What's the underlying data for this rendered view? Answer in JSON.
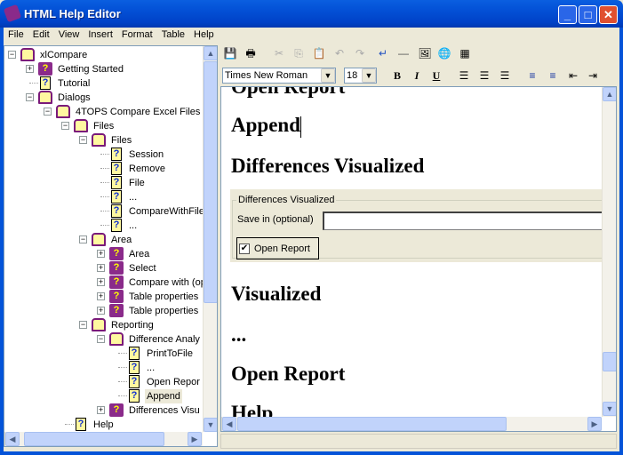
{
  "window": {
    "title": "HTML Help Editor"
  },
  "menu": [
    "File",
    "Edit",
    "View",
    "Insert",
    "Format",
    "Table",
    "Help"
  ],
  "tree": [
    {
      "label": "xlCompare",
      "d": 0,
      "t": "open",
      "e": "-"
    },
    {
      "label": "Getting Started",
      "d": 1,
      "t": "book",
      "e": "+"
    },
    {
      "label": "Tutorial",
      "d": 1,
      "t": "page",
      "e": ""
    },
    {
      "label": "Dialogs",
      "d": 1,
      "t": "open",
      "e": "-"
    },
    {
      "label": "4TOPS Compare Excel Files",
      "d": 2,
      "t": "open",
      "e": "-"
    },
    {
      "label": "Files",
      "d": 3,
      "t": "open",
      "e": "-"
    },
    {
      "label": "Files",
      "d": 4,
      "t": "open",
      "e": "-"
    },
    {
      "label": "Session",
      "d": 5,
      "t": "page",
      "e": ""
    },
    {
      "label": "Remove",
      "d": 5,
      "t": "page",
      "e": ""
    },
    {
      "label": "File",
      "d": 5,
      "t": "page",
      "e": ""
    },
    {
      "label": "...",
      "d": 5,
      "t": "page",
      "e": ""
    },
    {
      "label": "CompareWithFile",
      "d": 5,
      "t": "page",
      "e": ""
    },
    {
      "label": "...",
      "d": 5,
      "t": "page",
      "e": ""
    },
    {
      "label": "Area",
      "d": 4,
      "t": "open",
      "e": "-"
    },
    {
      "label": "Area",
      "d": 5,
      "t": "book",
      "e": "+"
    },
    {
      "label": "Select",
      "d": 5,
      "t": "book",
      "e": "+"
    },
    {
      "label": "Compare with (op",
      "d": 5,
      "t": "book",
      "e": "+"
    },
    {
      "label": "Table properties",
      "d": 5,
      "t": "book",
      "e": "+"
    },
    {
      "label": "Table properties",
      "d": 5,
      "t": "book",
      "e": "+"
    },
    {
      "label": "Reporting",
      "d": 4,
      "t": "open",
      "e": "-"
    },
    {
      "label": "Difference Analy",
      "d": 5,
      "t": "open",
      "e": "-"
    },
    {
      "label": "PrintToFile",
      "d": 6,
      "t": "page",
      "e": ""
    },
    {
      "label": "...",
      "d": 6,
      "t": "page",
      "e": ""
    },
    {
      "label": "Open Repor",
      "d": 6,
      "t": "page",
      "e": ""
    },
    {
      "label": "Append",
      "d": 6,
      "t": "page",
      "e": "",
      "selected": true
    },
    {
      "label": "Differences Visu",
      "d": 5,
      "t": "book",
      "e": "+"
    },
    {
      "label": "Help",
      "d": 3,
      "t": "page",
      "e": ""
    }
  ],
  "format": {
    "font": "Times New Roman",
    "size": "18"
  },
  "editor": {
    "headings": [
      "Open Report",
      "Append",
      "Differences Visualized",
      "Visualized",
      "...",
      "Open Report",
      "Help"
    ],
    "group_title": "Differences Visualized",
    "save_label": "Save in (optional)",
    "save_value": "",
    "checkbox_label": "Open Report",
    "checkbox_checked": true
  }
}
